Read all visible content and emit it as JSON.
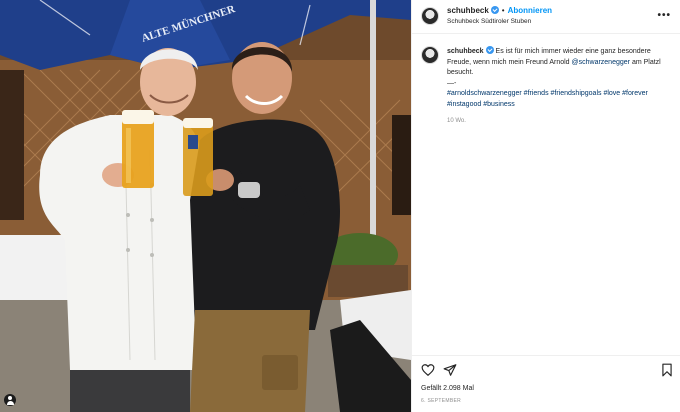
{
  "post": {
    "username": "schuhbeck",
    "follow_label": "Abonnieren",
    "separator": "•",
    "location": "Schuhbeck Südtiroler Stuben",
    "more_label": "•••"
  },
  "caption": {
    "username": "schuhbeck",
    "text_1": "Es ist für mich immer wieder eine ganz besondere Freude, wenn mich mein Freund Arnold",
    "mention": "@schwarzenegger",
    "text_2": "am Platzl besucht.",
    "divider": "—-",
    "hashtags": [
      "#arnoldschwarzenegger",
      "#friends",
      "#friendshipgoals",
      "#love",
      "#forever",
      "#instagood",
      "#business"
    ],
    "time": "10 Wo."
  },
  "actions": {
    "like_icon": "heart-icon",
    "share_icon": "send-icon",
    "save_icon": "bookmark-icon",
    "likes": "Gefällt 2.098 Mal",
    "date": "6. SEPTEMBER"
  },
  "photo": {
    "umbrella_text": "ALTE MÜNCHNER",
    "colors": {
      "umbrella": "#1f3f8a",
      "wall": "#7a5232",
      "chef_coat": "#f4f4f2",
      "shirt": "#1c1c1e",
      "pants": "#8a6a3a",
      "beer": "#e8a21f"
    }
  }
}
